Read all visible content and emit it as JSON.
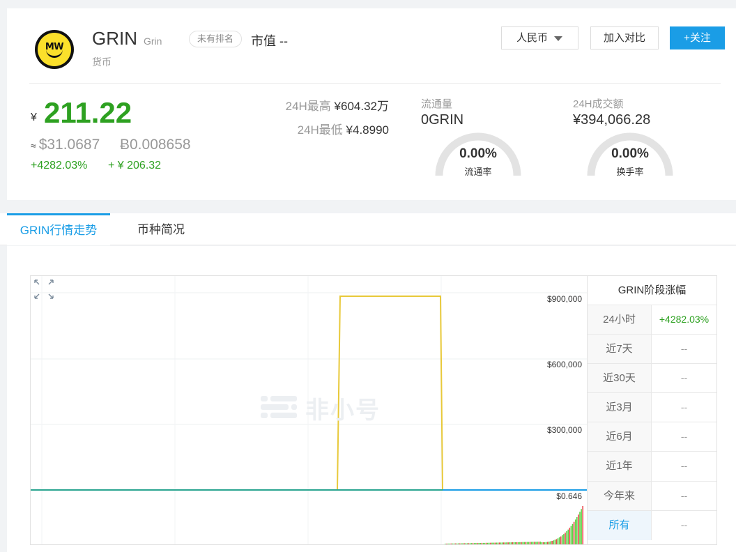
{
  "coin": {
    "name": "GRIN",
    "symbol": "Grin",
    "type": "货币",
    "rank_badge": "未有排名",
    "market_cap": "市值 --"
  },
  "toolbar": {
    "currency_label": "人民币",
    "compare_label": "加入对比",
    "follow_label": "+关注"
  },
  "price": {
    "yen_symbol": "¥",
    "main": "211.22",
    "usd": "$31.0687",
    "usd_prefix": "≈",
    "btc": "Ƀ0.008658",
    "change_pct": "+4282.03%",
    "change_abs": "+ ¥ 206.32"
  },
  "stats": {
    "high_label": "24H最高",
    "high_value": "¥604.32万",
    "low_label": "24H最低",
    "low_value": "¥4.8990",
    "circulation_label": "流通量",
    "circulation_value": "0GRIN",
    "circulation_rate_pct": "0.00%",
    "circulation_rate_label": "流通率",
    "volume_label": "24H成交额",
    "volume_value": "¥394,066.28",
    "turnover_pct": "0.00%",
    "turnover_label": "换手率"
  },
  "tabs": [
    {
      "label": "GRIN行情走势",
      "active": true
    },
    {
      "label": "币种简况",
      "active": false
    }
  ],
  "watermark": "非小号",
  "chart_data": {
    "type": "line",
    "y_tick_labels": [
      "$900,000",
      "$600,000",
      "$300,000",
      "$0.646"
    ],
    "note_series": [
      {
        "color": "#e8c93a"
      },
      {
        "color": "#1a9de6"
      },
      {
        "color": "#2aa590"
      }
    ],
    "volume_colors": {
      "up": "#5fd146",
      "down": "#e8474a"
    }
  },
  "period_table": {
    "title": "GRIN阶段涨幅",
    "rows": [
      {
        "label": "24小时",
        "value": "+4282.03%"
      },
      {
        "label": "近7天",
        "value": "--"
      },
      {
        "label": "近30天",
        "value": "--"
      },
      {
        "label": "近3月",
        "value": "--"
      },
      {
        "label": "近6月",
        "value": "--"
      },
      {
        "label": "近1年",
        "value": "--"
      },
      {
        "label": "今年来",
        "value": "--"
      },
      {
        "label": "所有",
        "value": "--"
      }
    ]
  },
  "colors": {
    "accent": "#1a9de6",
    "up": "#2ea121"
  }
}
